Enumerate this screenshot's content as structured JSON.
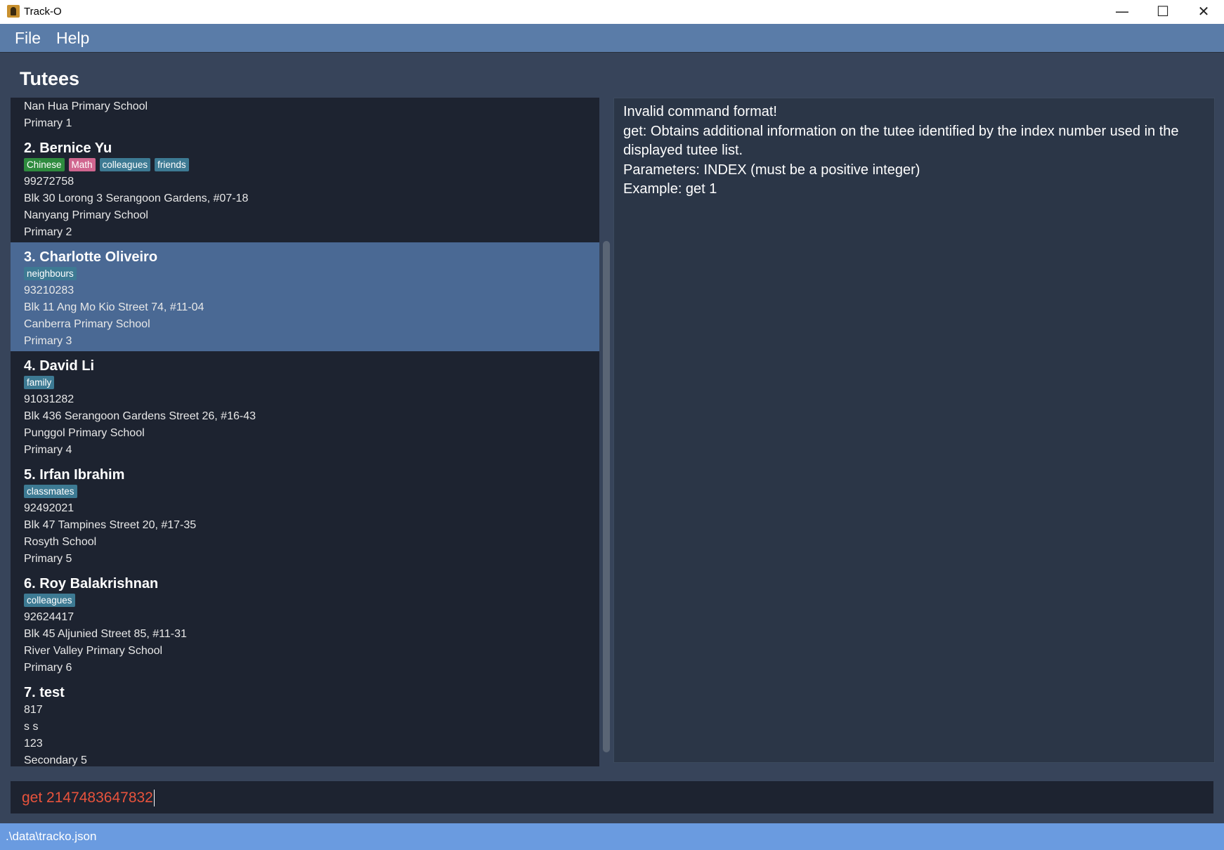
{
  "window": {
    "title": "Track-O",
    "minimize_glyph": "—",
    "maximize_glyph": "☐",
    "close_glyph": "✕"
  },
  "menu": {
    "file": "File",
    "help": "Help"
  },
  "tutees_title": "Tutees",
  "tag_colors": {
    "Chinese": "#2e8b3e",
    "Math": "#d0668f",
    "default": "#3d7a93"
  },
  "first_partial": {
    "school": "Nan Hua Primary School",
    "level": "Primary 1"
  },
  "tutees": [
    {
      "name": "2.  Bernice Yu",
      "tags": [
        "Chinese",
        "Math",
        "colleagues",
        "friends"
      ],
      "phone": "99272758",
      "address": "Blk 30 Lorong 3 Serangoon Gardens, #07-18",
      "school": "Nanyang Primary School",
      "level": "Primary 2"
    },
    {
      "name": "3.  Charlotte Oliveiro",
      "tags": [
        "neighbours"
      ],
      "phone": "93210283",
      "address": "Blk 11 Ang Mo Kio Street 74, #11-04",
      "school": "Canberra Primary School",
      "level": "Primary 3"
    },
    {
      "name": "4.  David Li",
      "tags": [
        "family"
      ],
      "phone": "91031282",
      "address": "Blk 436 Serangoon Gardens Street 26, #16-43",
      "school": "Punggol Primary School",
      "level": "Primary 4"
    },
    {
      "name": "5.  Irfan Ibrahim",
      "tags": [
        "classmates"
      ],
      "phone": "92492021",
      "address": "Blk 47 Tampines Street 20, #17-35",
      "school": "Rosyth School",
      "level": "Primary 5"
    },
    {
      "name": "6.  Roy Balakrishnan",
      "tags": [
        "colleagues"
      ],
      "phone": "92624417",
      "address": "Blk 45 Aljunied Street 85, #11-31",
      "school": "River Valley Primary School",
      "level": "Primary 6"
    },
    {
      "name": "7.  test",
      "tags": [],
      "phone": "817",
      "address": "s s",
      "school": "123",
      "level": "Secondary 5"
    }
  ],
  "result": {
    "lines": [
      "Invalid command format!",
      "get: Obtains additional information on the tutee identified by the index number used in the",
      "displayed tutee list.",
      "Parameters: INDEX (must be a positive integer)",
      "Example: get 1"
    ]
  },
  "command": {
    "value": "get 2147483647832"
  },
  "status": {
    "path": ".\\data\\tracko.json"
  }
}
